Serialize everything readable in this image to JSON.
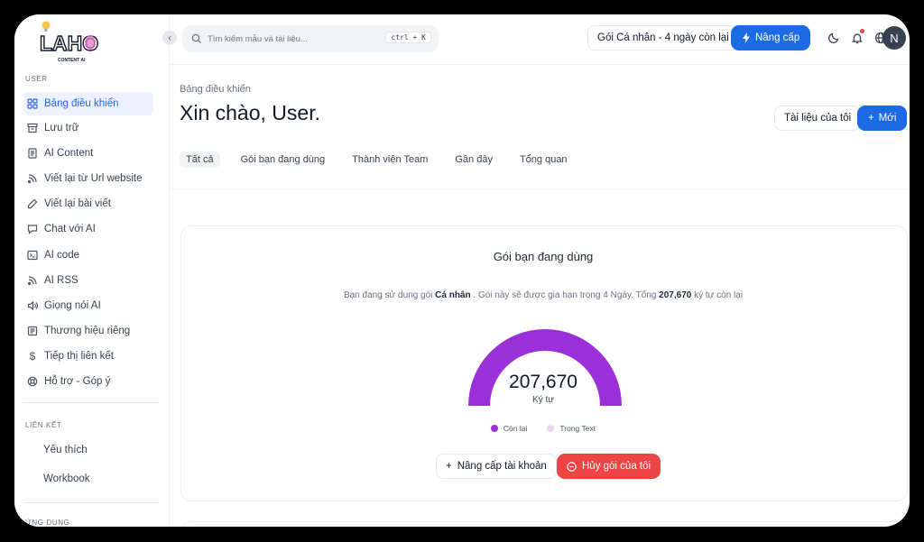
{
  "colors": {
    "accent": "#1d6ae5",
    "danger": "#ef4444",
    "gauge": "#9b30d9",
    "gauge_bg": "#ecd4f5"
  },
  "logo": {
    "text": "LAHO",
    "subtitle": "CONTENT AI"
  },
  "sidebar": {
    "section_user": "USER",
    "items": [
      {
        "label": "Bảng điều khiển",
        "icon": "dashboard-grid-icon",
        "active": true
      },
      {
        "label": "Lưu trữ",
        "icon": "archive-icon"
      },
      {
        "label": "AI Content",
        "icon": "document-icon"
      },
      {
        "label": "Viết lại từ Url website",
        "icon": "rss-icon"
      },
      {
        "label": "Viết lại bài viết",
        "icon": "pencil-icon"
      },
      {
        "label": "Chat với AI",
        "icon": "chat-icon"
      },
      {
        "label": "AI code",
        "icon": "terminal-icon"
      },
      {
        "label": "AI RSS",
        "icon": "rss-icon"
      },
      {
        "label": "Giọng nói AI",
        "icon": "speaker-icon"
      },
      {
        "label": "Thương hiệu riêng",
        "icon": "newspaper-icon"
      },
      {
        "label": "Tiếp thị liên kết",
        "icon": "dollar-icon"
      },
      {
        "label": "Hỗ trợ - Góp ý",
        "icon": "lifebuoy-icon"
      }
    ],
    "section_links": "LIÊN KẾT",
    "links": [
      "Yêu thích",
      "Workbook"
    ],
    "section_apps": "ỨNG DỤNG"
  },
  "topbar": {
    "search_placeholder": "Tìm kiếm mẫu và tài liệu...",
    "search_shortcut": "ctrl + K",
    "plan": "Gói Cá nhân - 4 ngày còn lại",
    "upgrade": "Nâng cấp",
    "avatar": "N"
  },
  "main": {
    "breadcrumb": "Bảng điều khiển",
    "greeting": "Xin chào, User.",
    "my_docs": "Tài liệu của tôi",
    "new": "Mới",
    "tabs": [
      "Tất cả",
      "Gói bạn đang dùng",
      "Thành viên Team",
      "Gần đây",
      "Tổng quan"
    ]
  },
  "plan_card": {
    "title": "Gói bạn đang dùng",
    "desc_1": "Bạn đang sử dụng gói ",
    "plan_name": "Cá nhân",
    "desc_2": " . Gói này sẽ được gia hạn trong 4 Ngày. Tổng ",
    "total": "207,670",
    "desc_3": " ký tự còn lại",
    "gauge_value": "207,670",
    "gauge_unit": "Ký tự",
    "gauge_fraction_remaining": 1.0,
    "legend": [
      "Còn lại",
      "Trong Text"
    ],
    "upgrade_account": "Nâng cấp tài khoản",
    "cancel_plan": "Hủy gói của tôi"
  }
}
